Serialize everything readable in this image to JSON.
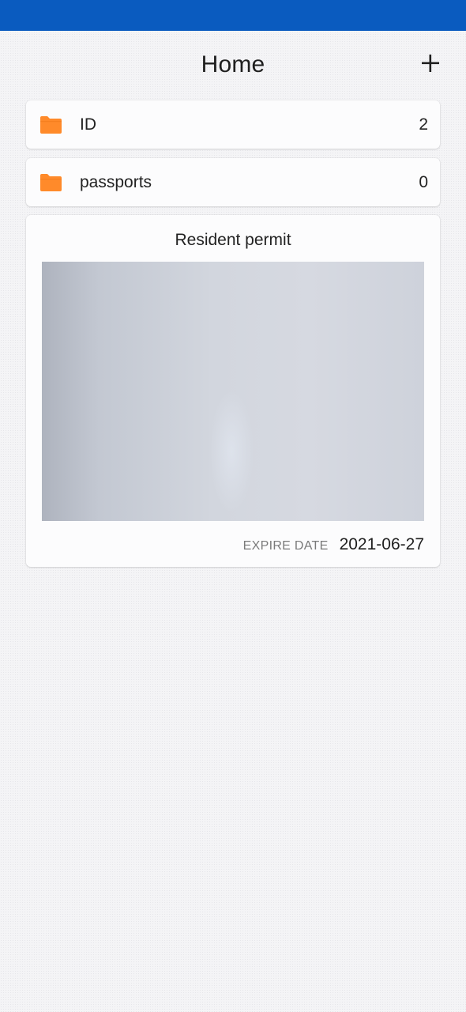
{
  "header": {
    "title": "Home",
    "add_icon": "plus-icon"
  },
  "folders": [
    {
      "name": "ID",
      "count": "2",
      "icon": "folder-icon"
    },
    {
      "name": "passports",
      "count": "0",
      "icon": "folder-icon"
    }
  ],
  "document": {
    "title": "Resident permit",
    "expire_label": "EXPIRE DATE",
    "expire_value": "2021-06-27"
  },
  "colors": {
    "status_bar": "#0a5bbf",
    "folder": "#ff8a2a",
    "background": "#f4f4f6"
  }
}
